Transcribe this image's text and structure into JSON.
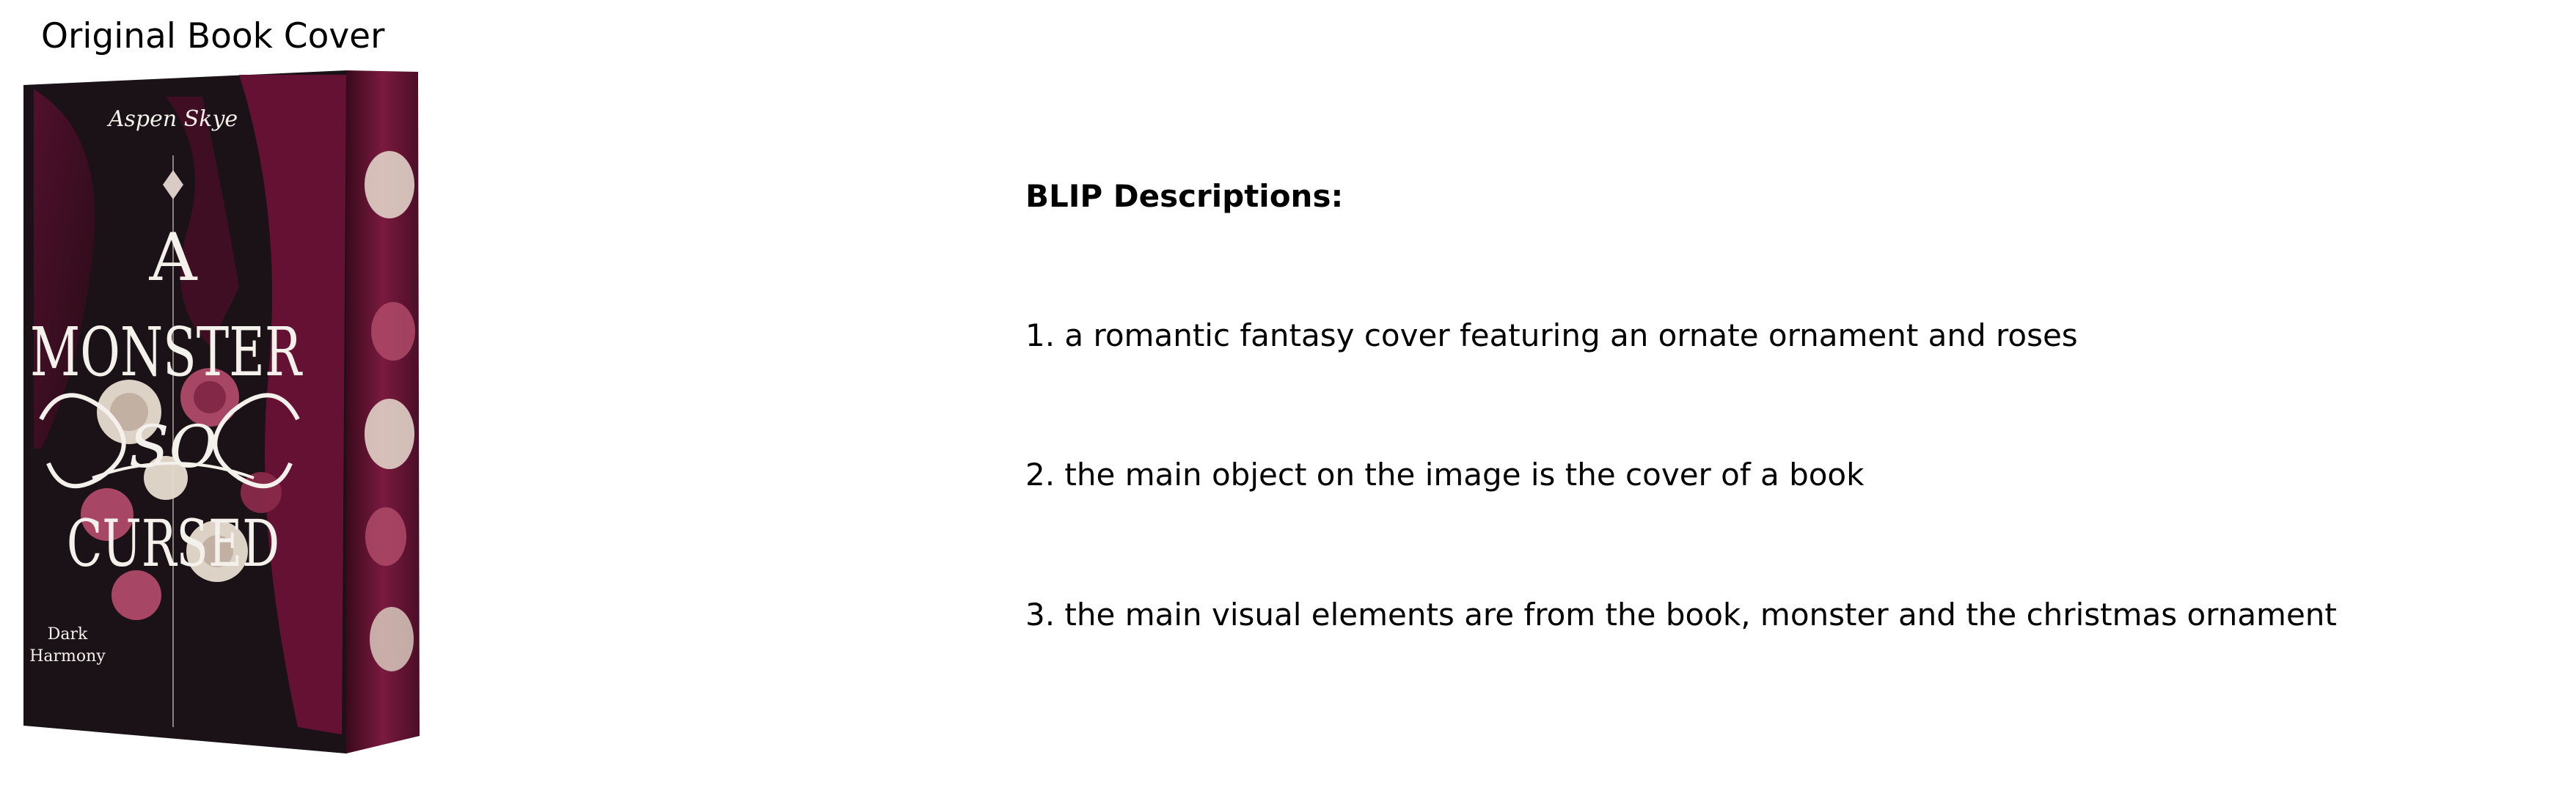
{
  "figure": {
    "title": "Original Book Cover"
  },
  "cover": {
    "author": "Aspen Skye",
    "title_line1": "A",
    "title_line2": "MONSTER",
    "title_line3": "SO",
    "title_line4": "CURSED",
    "series_line1": "Dark",
    "series_line2": "Harmony",
    "colors": {
      "background": "#1a1216",
      "burgundy": "#6e1236",
      "rose_pink": "#b04a6a",
      "rose_cream": "#e8ddd0",
      "title_white": "#f4f0ec"
    }
  },
  "descriptions": {
    "heading": "BLIP Descriptions:",
    "items": [
      "1. a romantic fantasy cover featuring an ornate ornament and roses",
      "2. the main object on the image is the cover of a book",
      "3. the main visual elements are from the book, monster and the christmas ornament"
    ]
  }
}
